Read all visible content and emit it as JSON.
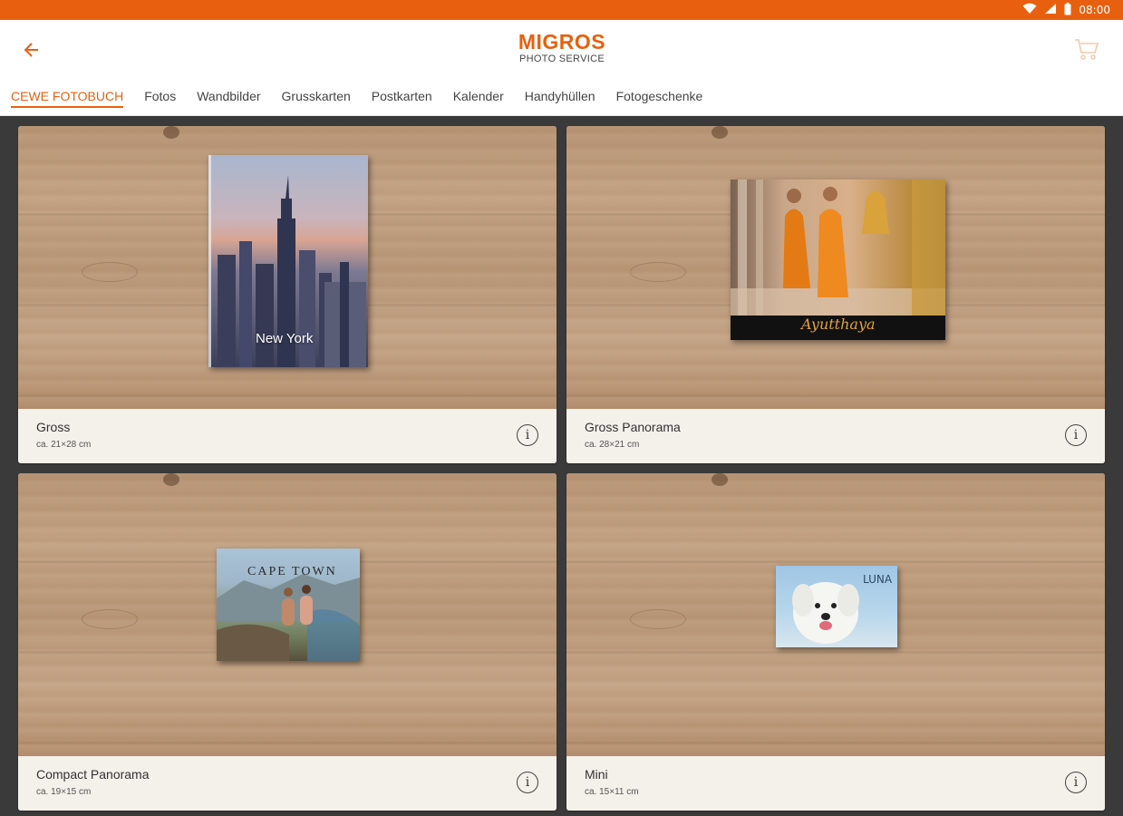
{
  "status_bar": {
    "time": "08:00",
    "icons": [
      "wifi-icon",
      "signal-icon",
      "battery-icon"
    ],
    "background_color": "#e8600f"
  },
  "header": {
    "logo_title": "MIGROS",
    "logo_subtitle": "PHOTO SERVICE",
    "accent_color": "#e8600f",
    "back_icon": "arrow-left-icon",
    "cart_icon": "cart-icon"
  },
  "tabs": [
    {
      "label": "CEWE FOTOBUCH",
      "active": true
    },
    {
      "label": "Fotos",
      "active": false
    },
    {
      "label": "Wandbilder",
      "active": false
    },
    {
      "label": "Grusskarten",
      "active": false
    },
    {
      "label": "Postkarten",
      "active": false
    },
    {
      "label": "Kalender",
      "active": false
    },
    {
      "label": "Handyhüllen",
      "active": false
    },
    {
      "label": "Fotogeschenke",
      "active": false
    }
  ],
  "products": [
    {
      "name": "Gross",
      "size": "ca. 21×28 cm",
      "cover_text": "New York"
    },
    {
      "name": "Gross Panorama",
      "size": "ca. 28×21 cm",
      "cover_text": "Ayutthaya"
    },
    {
      "name": "Compact Panorama",
      "size": "ca. 19×15 cm",
      "cover_text": "CAPE TOWN"
    },
    {
      "name": "Mini",
      "size": "ca. 15×11 cm",
      "cover_text": "LUNA"
    }
  ]
}
